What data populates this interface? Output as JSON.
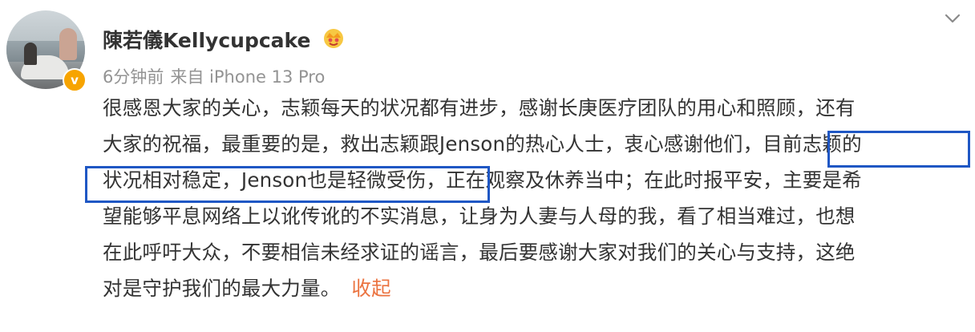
{
  "author": {
    "name": "陳若儀Kellycupcake",
    "badge_icon": "crown-icon",
    "verified_icon": "verified-badge-icon",
    "verified_color": "#f7a400"
  },
  "meta": {
    "time": "6分钟前",
    "source": "来自 iPhone 13 Pro"
  },
  "post": {
    "lines": [
      "很感恩大家的关心，志颖每天的状况都有进步，感谢长庚医疗团队的用心和照顾，还有",
      "大家的祝福，最重要的是，救出志颖跟Jenson的热心人士，衷心感谢他们，目前志颖的",
      "状况相对稳定，Jenson也是轻微受伤，正在观察及休养当中；在此时报平安，主要是希",
      "望能够平息网络上以讹传讹的不实消息，让身为人妻与人母的我，看了相当难过，也想",
      "在此呼吁大众，不要相信未经求证的谣言，最后要感谢大家对我们的关心与支持，这绝",
      "对是守护我们的最大力量。"
    ],
    "collapse_label": "收起"
  },
  "colors": {
    "link": "#eb7340",
    "highlight_box": "#1f57c4",
    "meta_text": "#939393"
  }
}
